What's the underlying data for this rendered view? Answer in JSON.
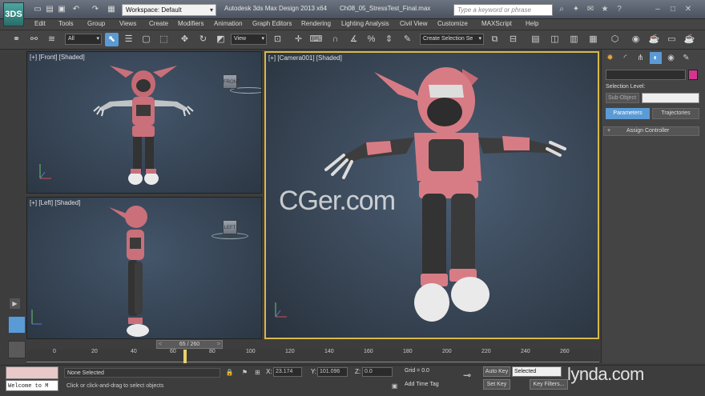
{
  "app": {
    "logo": "3DS",
    "title": "Autodesk 3ds Max Design 2013 x64",
    "file": "Ch08_05_StressTest_Final.max",
    "workspace": "Workspace: Default",
    "search_placeholder": "Type a keyword or phrase"
  },
  "menus": [
    "Edit",
    "Tools",
    "Group",
    "Views",
    "Create",
    "Modifiers",
    "Animation",
    "Graph Editors",
    "Rendering",
    "Lighting Analysis",
    "Civil View",
    "Customize",
    "MAXScript",
    "Help"
  ],
  "toolbar": {
    "selection_filter": "All",
    "ref_coord": "View",
    "named_selection": "Create Selection Se"
  },
  "viewports": {
    "front": {
      "label": "[+] [Front] [Shaded]"
    },
    "left": {
      "label": "[+] [Left] [Shaded]"
    },
    "camera": {
      "label": "[+] [Camera001] [Shaded]"
    }
  },
  "viewcube": {
    "front": "FRONT",
    "left": "LEFT"
  },
  "watermark": "CGer.com",
  "command_panel": {
    "selection_level": "Selection Level:",
    "sub_object": "Sub-Object",
    "tab_parameters": "Parameters",
    "tab_trajectories": "Trajectories",
    "rollout_toggle": "+",
    "rollout_label": "Assign Controller",
    "color_swatch": "#d3358f"
  },
  "timeline": {
    "frame": "65 / 260",
    "ticks": [
      "0",
      "20",
      "40",
      "60",
      "80",
      "100",
      "120",
      "140",
      "160",
      "180",
      "200",
      "220",
      "240",
      "260"
    ]
  },
  "status": {
    "welcome": "Welcome to M",
    "selection": "None Selected",
    "prompt": "Click or click-and-drag to select objects",
    "x_label": "X:",
    "x_value": "23.174",
    "y_label": "Y:",
    "y_value": "101.096",
    "z_label": "Z:",
    "z_value": "0.0",
    "grid": "Grid = 0.0",
    "add_time_tag": "Add Time Tag",
    "auto_key": "Auto Key",
    "set_key": "Set Key",
    "key_mode": "Selected",
    "key_filters": "Key Filters..."
  },
  "branding": "lynda.com"
}
